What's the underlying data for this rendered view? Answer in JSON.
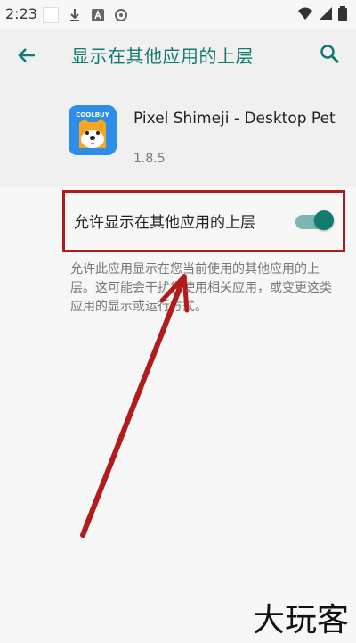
{
  "status_bar": {
    "time": "2:23"
  },
  "app_bar": {
    "title": "显示在其他应用的上层"
  },
  "app_info": {
    "name": "Pixel Shimeji - Desktop Pet",
    "version": "1.8.5",
    "icon_text": "COOLBUY"
  },
  "setting": {
    "label": "允许显示在其他应用的上层",
    "enabled": true
  },
  "description": "允许此应用显示在您当前使用的其他应用的上层。这可能会干扰您使用相关应用，或变更这类应用的显示或运行方式。",
  "watermark": "大玩客",
  "colors": {
    "accent": "#137a6f",
    "highlight_box": "#b01b1b",
    "arrow": "#b01b1b"
  }
}
